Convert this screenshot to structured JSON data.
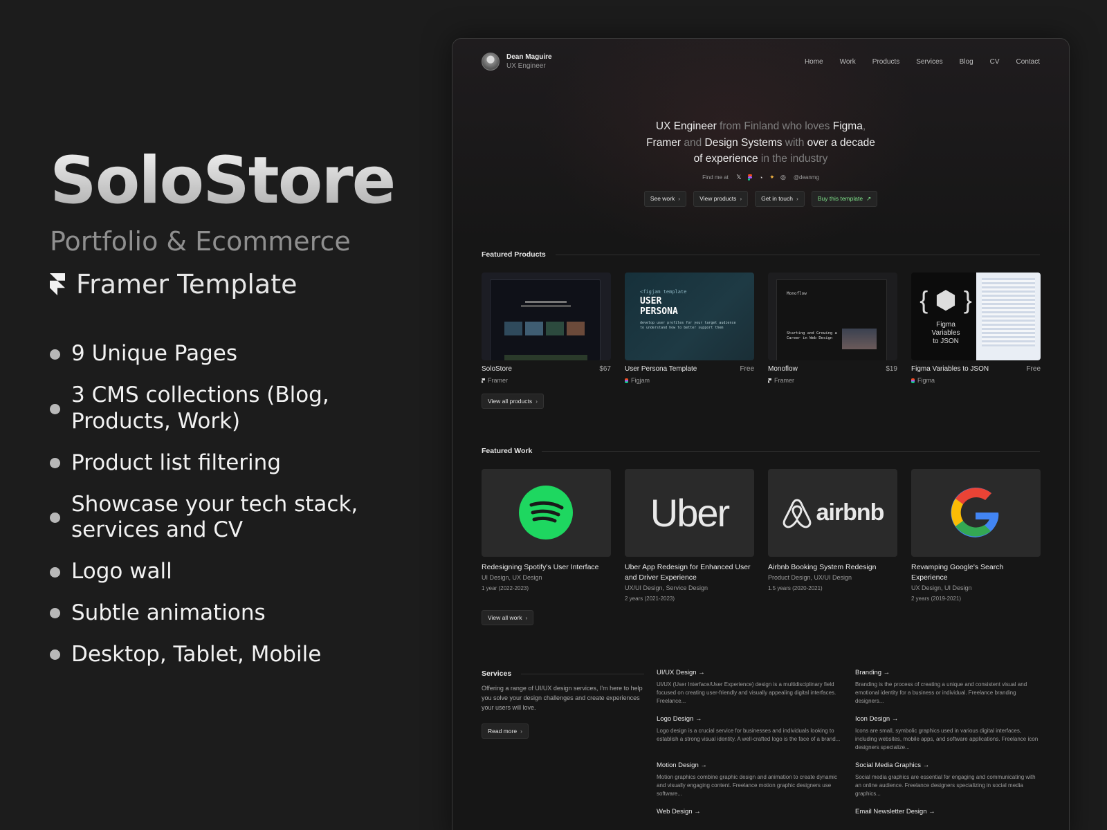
{
  "promo": {
    "title": "SoloStore",
    "subtitle": "Portfolio & Ecommerce",
    "framer_label": "Framer Template",
    "features": [
      "9 Unique Pages",
      "3 CMS collections (Blog, Products, Work)",
      "Product list filtering",
      "Showcase your tech stack, services and CV",
      "Logo wall",
      "Subtle animations",
      "Desktop, Tablet, Mobile"
    ]
  },
  "site": {
    "owner_name": "Dean Maguire",
    "owner_role": "UX Engineer",
    "nav": [
      "Home",
      "Work",
      "Products",
      "Services",
      "Blog",
      "CV",
      "Contact"
    ],
    "hero": {
      "l1a": "UX Engineer",
      "l1b": " from Finland who loves ",
      "l1c": "Figma",
      "l1d": ",",
      "l2a": "Framer",
      "l2b": " and ",
      "l2c": "Design Systems",
      "l2d": " with ",
      "l2e": "over a decade",
      "l3a": "of experience",
      "l3b": " in the industry"
    },
    "find_me": "Find me at",
    "handle": "@deanmg",
    "hero_buttons": [
      "See work",
      "View products",
      "Get in touch",
      "Buy this template"
    ],
    "featured_products_title": "Featured Products",
    "products": [
      {
        "name": "SoloStore",
        "price": "$67",
        "tool": "Framer"
      },
      {
        "name": "User Persona Template",
        "price": "Free",
        "tool": "Figjam"
      },
      {
        "name": "Monoflow",
        "price": "$19",
        "tool": "Framer"
      },
      {
        "name": "Figma Variables to JSON",
        "price": "Free",
        "tool": "Figma"
      }
    ],
    "persona_thumb": {
      "small": "<figjam template",
      "big1": "USER",
      "big2": "PERSONA",
      "body": "develop user profiles for your target audience to understand how to better support them"
    },
    "monoflow_thumb": {
      "brand": "Monoflow",
      "headline1": "Starting and Growing a",
      "headline2": "Career in Web Design"
    },
    "figvars_thumb": {
      "l1": "Figma",
      "l2": "Variables",
      "l3": "to JSON"
    },
    "view_all_products": "View all products",
    "featured_work_title": "Featured Work",
    "work": [
      {
        "title": "Redesigning Spotify's User Interface",
        "tags": "UI Design, UX Design",
        "duration": "1 year (2022-2023)",
        "logo": "spotify"
      },
      {
        "title": "Uber App Redesign for Enhanced User and Driver Experience",
        "tags": "UX/UI Design, Service Design",
        "duration": "2 years (2021-2023)",
        "logo": "Uber"
      },
      {
        "title": "Airbnb Booking System Redesign",
        "tags": "Product Design, UX/UI Design",
        "duration": "1.5 years (2020-2021)",
        "logo": "airbnb"
      },
      {
        "title": "Revamping Google's Search Experience",
        "tags": "UX Design, UI Design",
        "duration": "2 years (2019-2021)",
        "logo": "google"
      }
    ],
    "view_all_work": "View all work",
    "services_title": "Services",
    "services_desc": "Offering a range of UI/UX design services, I'm here to help you solve your design challenges and create experiences your users will love.",
    "read_more": "Read more",
    "services": [
      {
        "title": "UI/UX Design",
        "desc": "UI/UX (User Interface/User Experience) design is a multidisciplinary field focused on creating user-friendly and visually appealing digital interfaces. Freelance..."
      },
      {
        "title": "Branding",
        "desc": "Branding is the process of creating a unique and consistent visual and emotional identity for a business or individual. Freelance branding designers..."
      },
      {
        "title": "Logo Design",
        "desc": "Logo design is a crucial service for businesses and individuals looking to establish a strong visual identity. A well-crafted logo is the face of a brand..."
      },
      {
        "title": "Icon Design",
        "desc": "Icons are small, symbolic graphics used in various digital interfaces, including websites, mobile apps, and software applications. Freelance icon designers specialize..."
      },
      {
        "title": "Motion Design",
        "desc": "Motion graphics combine graphic design and animation to create dynamic and visually engaging content. Freelance motion graphic designers use software..."
      },
      {
        "title": "Social Media Graphics",
        "desc": "Social media graphics are essential for engaging and communicating with an online audience. Freelance designers specializing in social media graphics..."
      },
      {
        "title": "Web Design",
        "desc": ""
      },
      {
        "title": "Email Newsletter Design",
        "desc": ""
      }
    ]
  },
  "colors": {
    "accent_green": "#7ee28a",
    "spotify": "#1ed760",
    "bg": "#1c1c1c"
  }
}
